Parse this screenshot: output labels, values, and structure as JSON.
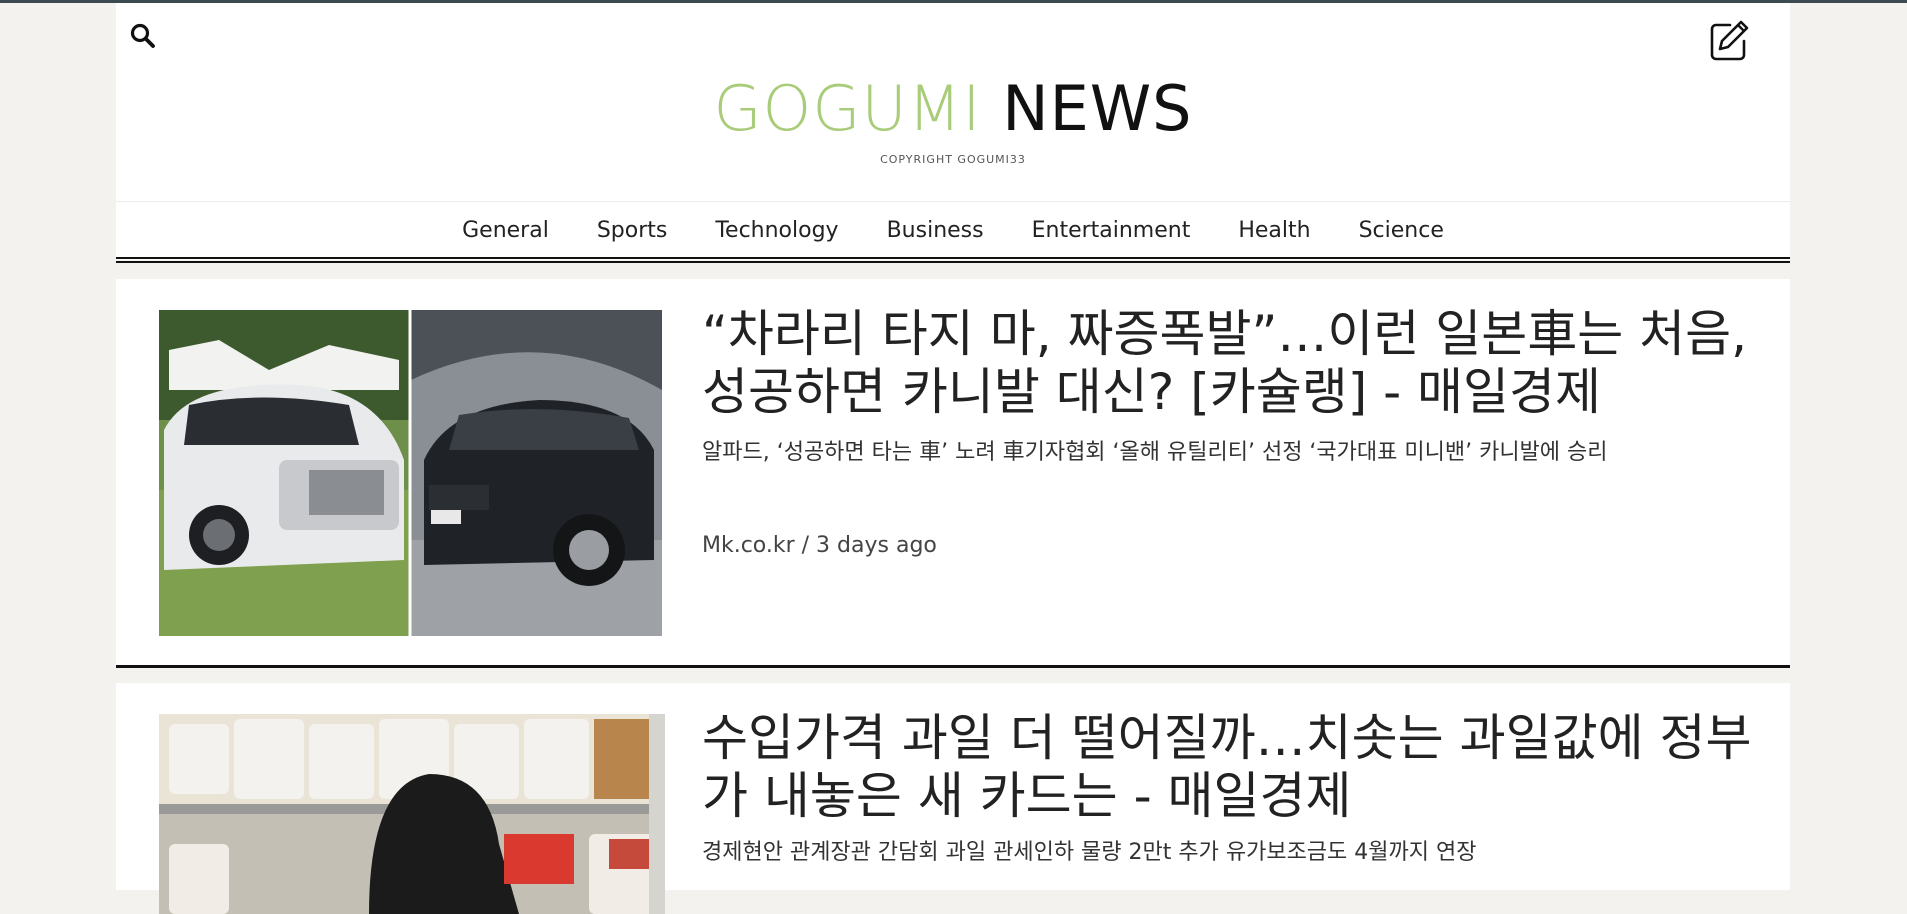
{
  "header": {
    "logo_part1": "GOGUMI",
    "logo_part2": " NEWS",
    "copyright": "COPYRIGHT GOGUMI33"
  },
  "nav": {
    "items": [
      "General",
      "Sports",
      "Technology",
      "Business",
      "Entertainment",
      "Health",
      "Science"
    ]
  },
  "articles": [
    {
      "title": "“차라리 타지 마, 짜증폭발”…이런 일본車는 처음, 성공하면 카니발 대신? [카슐랭] - 매일경제",
      "summary": "알파드, ‘성공하면 타는 車’ 노려 車기자협회 ‘올해 유틸리티’ 선정 ‘국가대표 미니밴’ 카니발에 승리",
      "source": "Mk.co.kr",
      "time": "3 days ago",
      "meta": "Mk.co.kr / 3 days ago"
    },
    {
      "title": "수입가격 과일 더 떨어질까…치솟는 과일값에 정부가 내놓은 새 카드는 - 매일경제",
      "summary": "경제현안 관계장관 간담회 과일 관세인하 물량 2만t 추가 유가보조금도 4월까지 연장"
    }
  ],
  "colors": {
    "logo_green": "#a8cc79",
    "logo_black": "#111111",
    "page_bg": "#f3f2ee"
  },
  "icons": {
    "search": "search-icon",
    "edit": "edit-icon"
  }
}
